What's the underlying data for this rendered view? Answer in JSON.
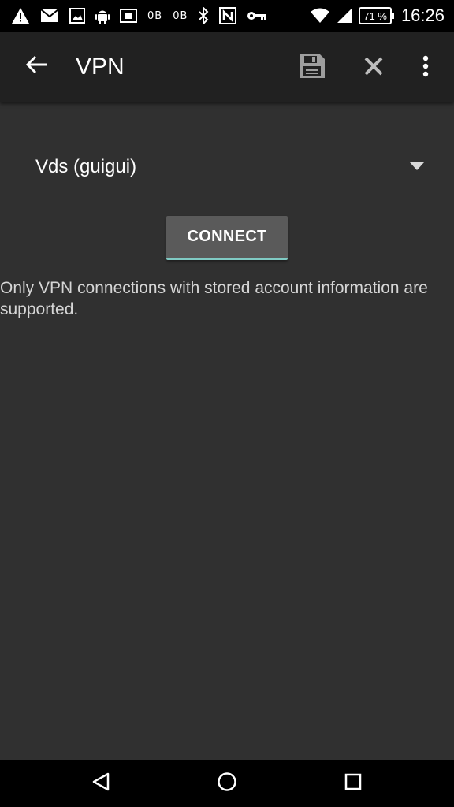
{
  "status_bar": {
    "icons": [
      "warning-icon",
      "email-icon",
      "image-icon",
      "android-icon",
      "sim-icon",
      "bluetooth-icon",
      "nfc-icon",
      "vpn-key-icon",
      "wifi-icon",
      "signal-icon"
    ],
    "data_down": "0B",
    "data_up": "0B",
    "battery": "71 %",
    "time": "16:26"
  },
  "app_bar": {
    "title": "VPN",
    "icons": [
      "back-arrow-icon",
      "save-icon",
      "close-icon",
      "more-vert-icon"
    ]
  },
  "vpn_spinner": {
    "selected": "Vds (guigui)"
  },
  "connect_button": {
    "label": "CONNECT"
  },
  "info": {
    "text": "Only VPN connections with stored account information are supported."
  },
  "nav_bar": {
    "icons": [
      "nav-back-icon",
      "nav-home-icon",
      "nav-recents-icon"
    ]
  },
  "colors": {
    "background": "#303030",
    "app_bar": "#212121",
    "accent": "#80cbc4"
  }
}
